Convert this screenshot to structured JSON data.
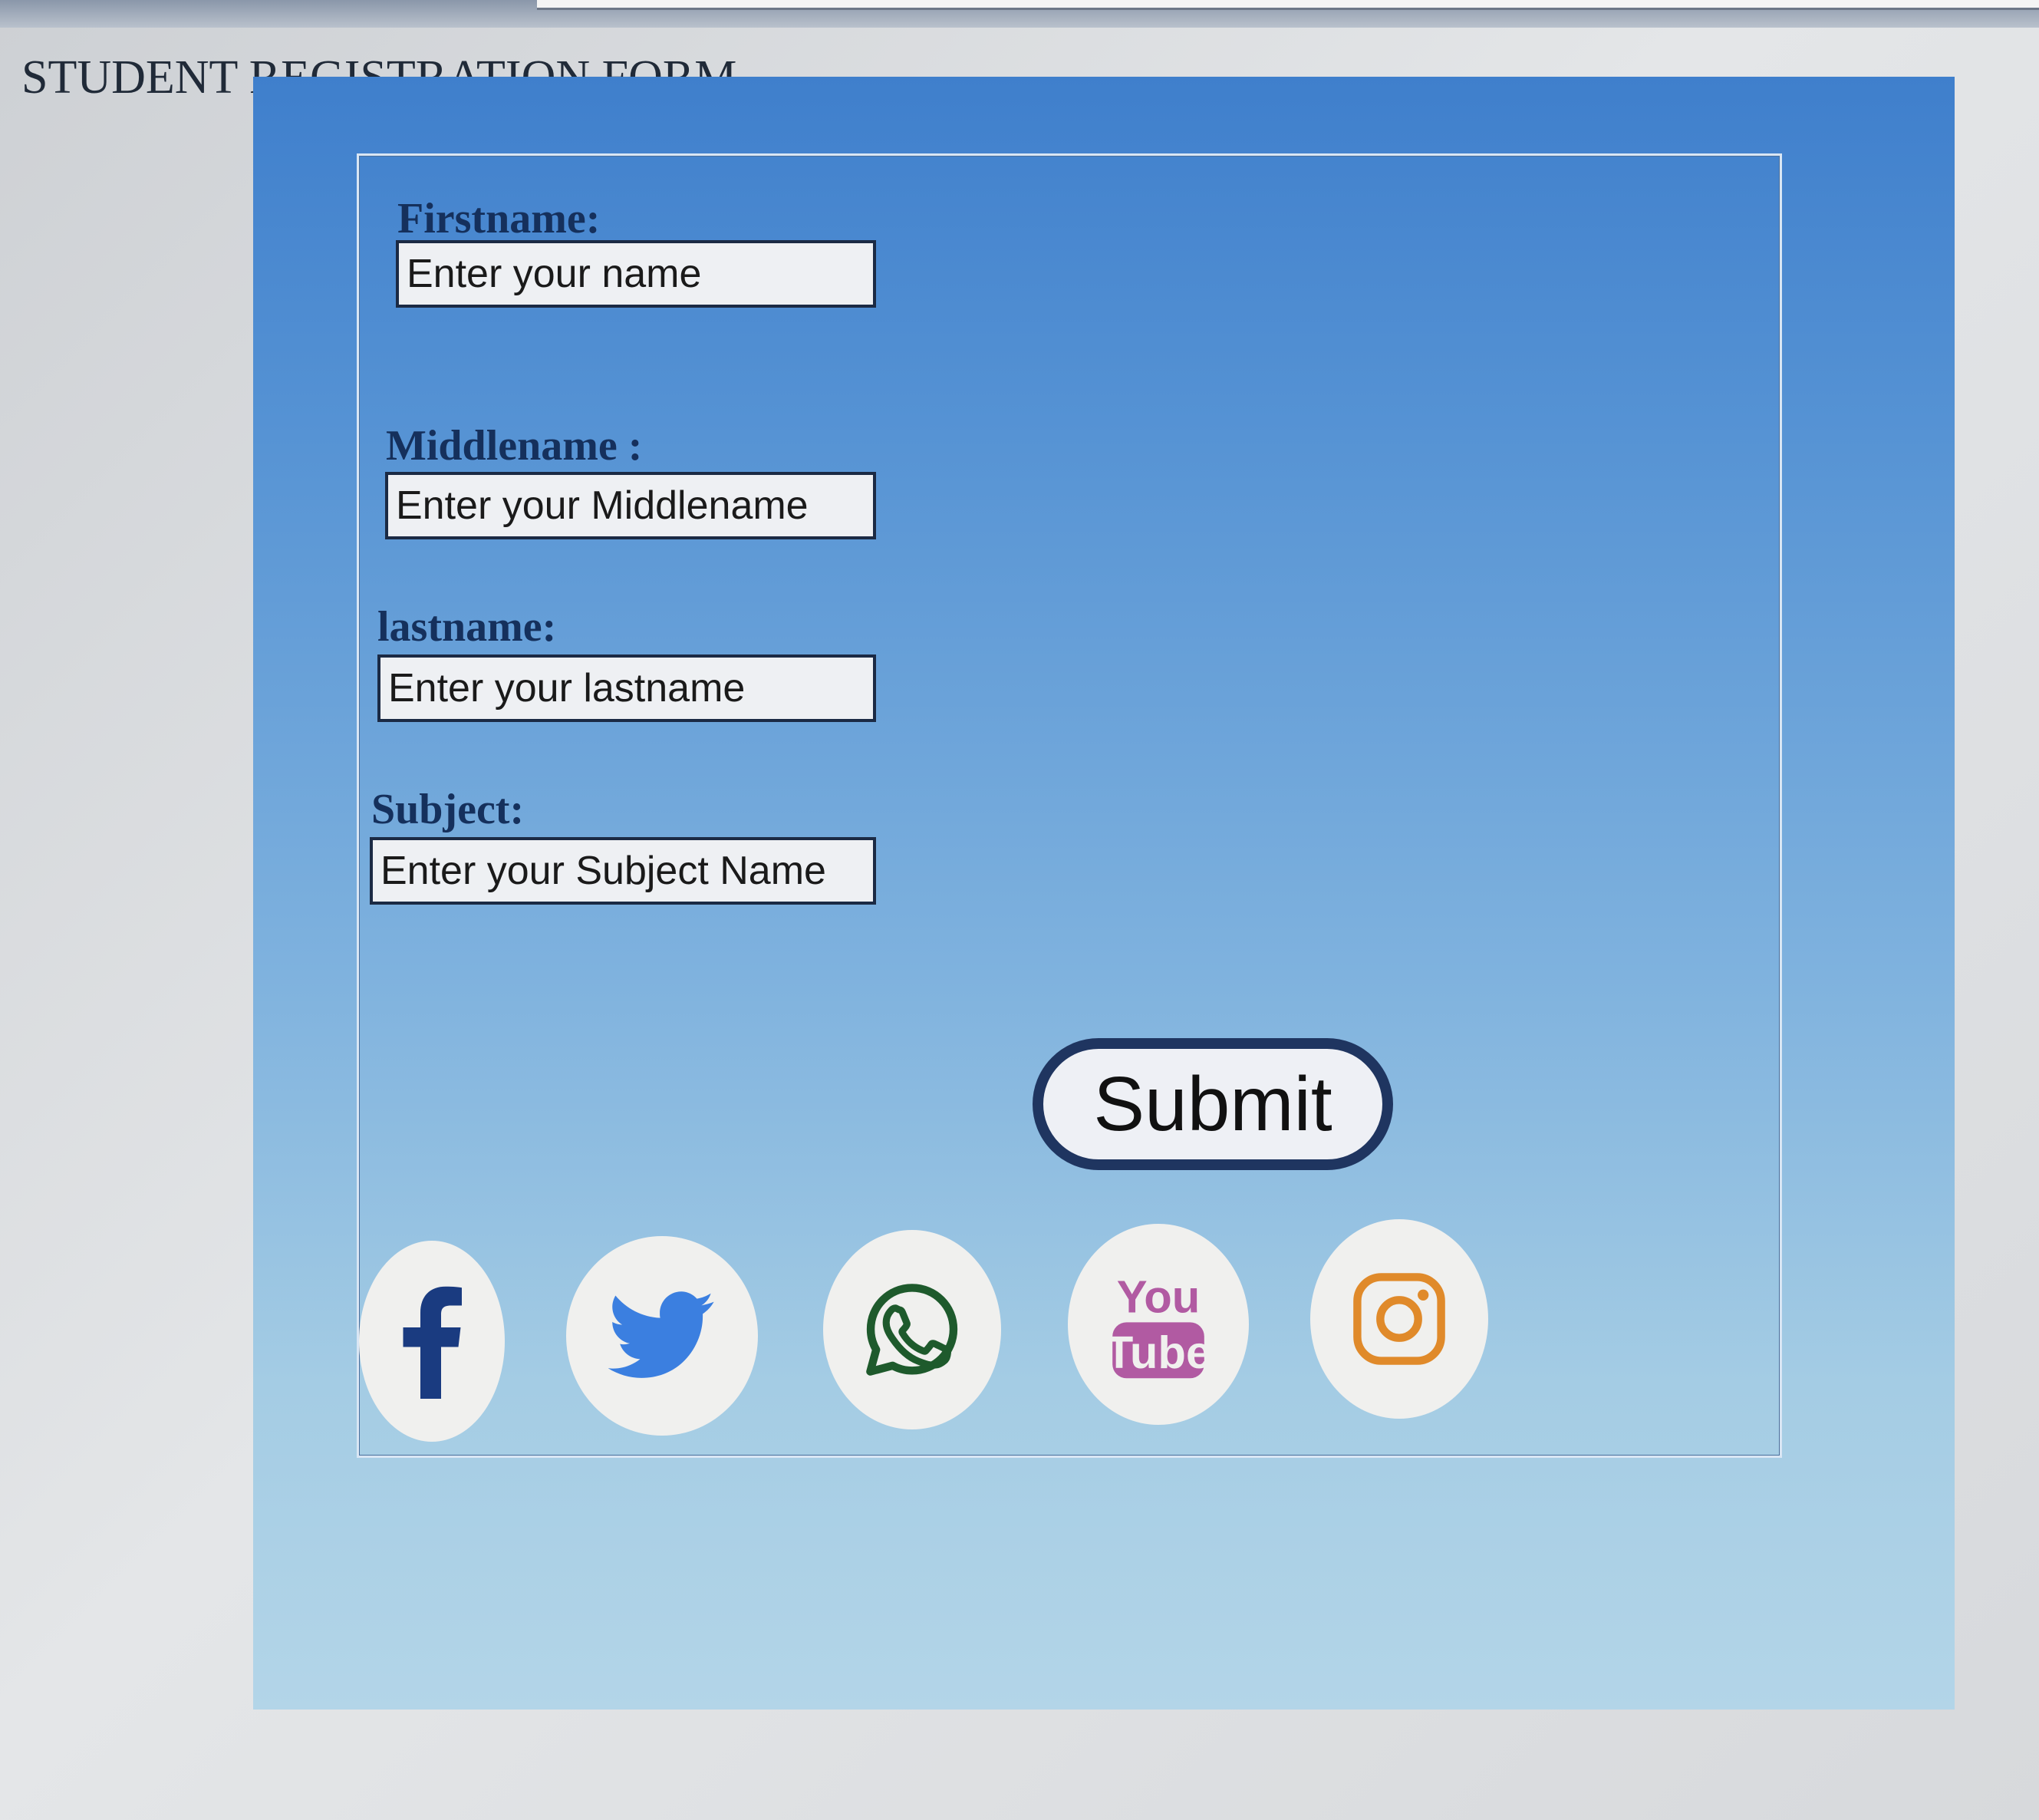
{
  "page": {
    "title": "STUDENT REGISTRATION FORM"
  },
  "form": {
    "fields": [
      {
        "label": "Firstname:",
        "placeholder": "Enter your name"
      },
      {
        "label": "Middlename :",
        "placeholder": "Enter your Middlename"
      },
      {
        "label": "lastname:",
        "placeholder": "Enter your lastname"
      },
      {
        "label": "Subject:",
        "placeholder": "Enter your Subject Name"
      }
    ],
    "submit_label": "Submit"
  },
  "social": {
    "icons": [
      {
        "name": "facebook-icon",
        "color": "#1a3b80"
      },
      {
        "name": "twitter-icon",
        "color": "#3b7fe0"
      },
      {
        "name": "whatsapp-icon",
        "color": "#1e5a2c"
      },
      {
        "name": "youtube-icon",
        "color": "#b15aa2",
        "text_top": "You",
        "text_bottom": "Tube"
      },
      {
        "name": "instagram-icon",
        "color": "#e08a2a"
      }
    ]
  },
  "colors": {
    "panel_top": "#3f7fcc",
    "panel_bottom": "#b3d5e8",
    "label_text": "#15305c",
    "button_border": "#1f3560"
  }
}
